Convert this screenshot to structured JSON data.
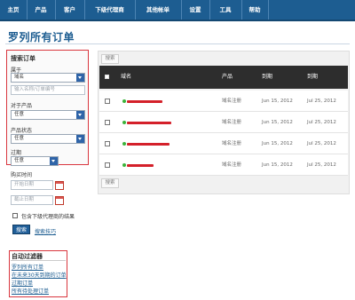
{
  "nav": {
    "items": [
      "主页",
      "产品",
      "客户",
      "下级代理商",
      "其他帐单",
      "设置",
      "工具",
      "帮助"
    ]
  },
  "page": {
    "title": "罗列所有订单"
  },
  "search": {
    "title": "搜索订单",
    "field_label": "属于",
    "field_value": "域名",
    "keyword_placeholder": "输入名称/订单编号",
    "product_label": "对于产品",
    "product_value": "任意",
    "status_label": "产品状态",
    "status_value": "任意",
    "expiry_label": "过期",
    "expiry_value": "任意",
    "purchase_label": "购买时间",
    "start_placeholder": "开始日期",
    "end_placeholder": "截止日期",
    "include_sub_label": "包含下级代理商的结果",
    "search_button": "搜索",
    "tips_link": "搜索技巧"
  },
  "auto_filters": {
    "title": "自动过滤器",
    "links": [
      "罗列所有订单",
      "在未来30天到期的订单",
      "过期订单",
      "所有待处理订单"
    ]
  },
  "orders": {
    "filter_button": "搜索",
    "columns": {
      "name": "域名",
      "product": "产品",
      "created": "到期",
      "expiry": "到期"
    },
    "rows": [
      {
        "product": "域名注册",
        "created": "Jun 15, 2012",
        "expiry": "Jul 25, 2012"
      },
      {
        "product": "域名注册",
        "created": "Jun 15, 2012",
        "expiry": "Jul 25, 2012"
      },
      {
        "product": "域名注册",
        "created": "Jun 15, 2012",
        "expiry": "Jul 25, 2012"
      },
      {
        "product": "域名注册",
        "created": "Jun 15, 2012",
        "expiry": "Jul 25, 2012"
      }
    ]
  },
  "colors": {
    "nav_bg": "#1d5d91",
    "highlight_border": "#d9363e",
    "table_header": "#2d2d2d",
    "status_active": "#3bb33b",
    "redaction": "#d4202a"
  }
}
